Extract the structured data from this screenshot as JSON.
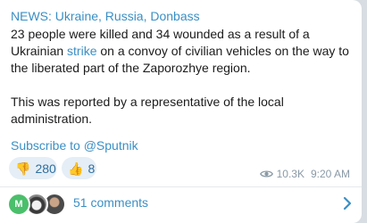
{
  "post": {
    "title": "NEWS: Ukraine, Russia, Donbass",
    "body_pre": "23 people were killed and 34 wounded as a result of a Ukrainian ",
    "body_link": "strike",
    "body_post": " on a convoy of civilian vehicles on the way to the liberated part of the Zaporozhye region.",
    "paragraph2": "This was reported by a representative of the local administration.",
    "subscribe": "Subscribe to @Sputnik"
  },
  "reactions": [
    {
      "emoji": "👎",
      "count": "280",
      "icon": "thumbs-down-icon"
    },
    {
      "emoji": "👍",
      "count": "8",
      "icon": "thumbs-up-icon"
    }
  ],
  "meta": {
    "views": "10.3K",
    "time": "9:20 AM",
    "icon": "eye-icon"
  },
  "comments": {
    "avatar_initial": "M",
    "label": "51 comments",
    "icon": "chevron-right-icon"
  },
  "colors": {
    "link": "#3a8fc5",
    "avatar_green": "#4bbf6b",
    "reaction_bg": "#e5eef6"
  }
}
